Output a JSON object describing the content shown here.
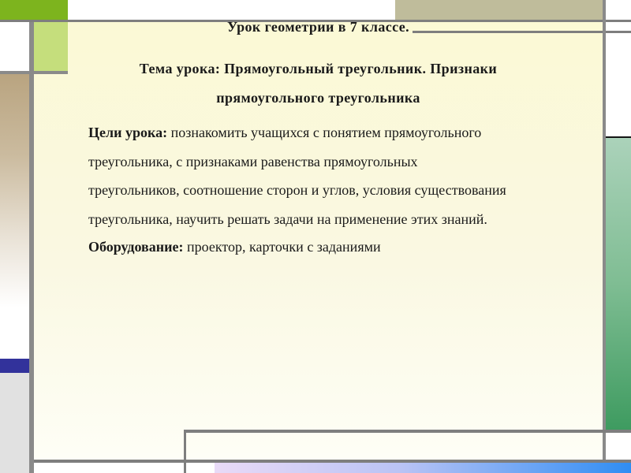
{
  "slide": {
    "title": "Урок геометрии в 7 классе.",
    "topic": {
      "line1": "Тема урока: Прямоугольный треугольник. Признаки",
      "line2": "прямоугольного треугольника"
    },
    "goals": {
      "label": "Цели урока:",
      "line1": " познакомить учащихся с понятием прямоугольного",
      "line2": "треугольника, с признаками равенства прямоугольных",
      "line3": "треугольников, соотношение сторон и углов, условия существования",
      "line4": "треугольника, научить решать задачи на применение этих знаний."
    },
    "equipment": {
      "label": "Оборудование:",
      "text": " проектор, карточки с заданиями"
    }
  },
  "colors": {
    "slide_background_top": "#fbf9d5",
    "slide_background_bottom": "#fefef6",
    "top_left_green": "#7db41e",
    "light_green_square": "#c5de7c",
    "tan_top_bar": "#bfbc9b",
    "left_tan_gradient": "#b9a480",
    "indigo_bar": "#32329b",
    "gray_lines": "#7e7e7e",
    "gray_strip": "#e1e1e1",
    "right_panel_green_top": "#abd2ba",
    "right_panel_green_bottom": "#3e9b60",
    "bottom_bar_left": "#e9daf7",
    "bottom_bar_right": "#2f8df3",
    "text": "#1a1a1a"
  }
}
